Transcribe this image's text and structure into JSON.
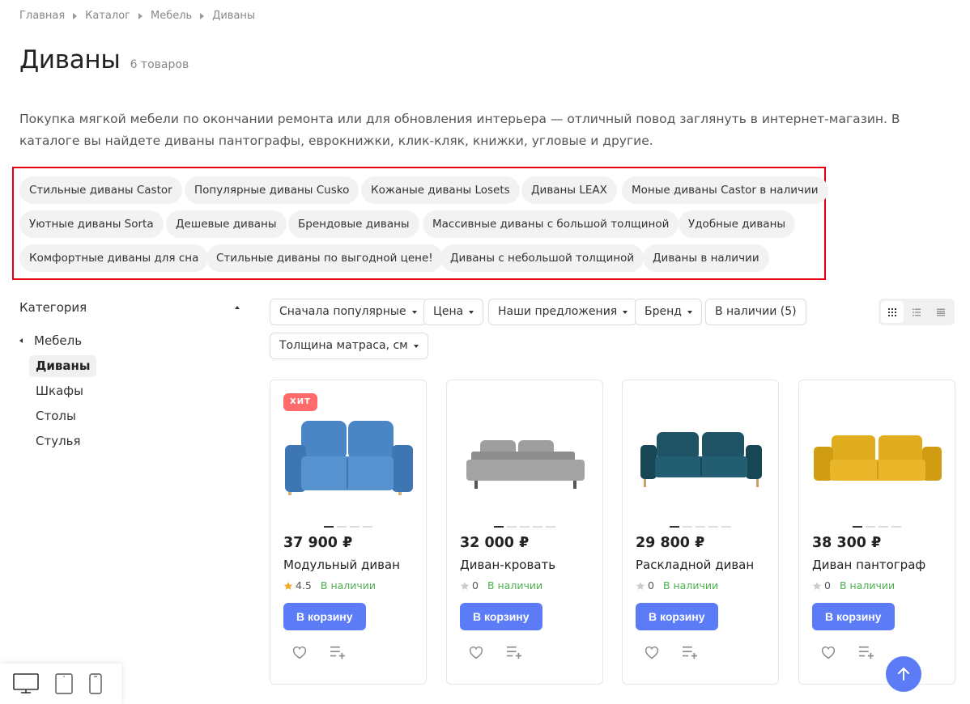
{
  "breadcrumb": [
    "Главная",
    "Каталог",
    "Мебель",
    "Диваны"
  ],
  "page": {
    "title": "Диваны",
    "count": "6 товаров",
    "description": "Покупка мягкой мебели по окончании ремонта или для обновления интерьера — отличный повод заглянуть в интернет-магазин. В каталоге вы найдете диваны пантографы, еврокнижки, клик-кляк, книжки, угловые и другие."
  },
  "tags": [
    "Стильные диваны Castor",
    "Популярные диваны Cusko",
    "Кожаные диваны Losets",
    "Диваны LEAX",
    "Моные диваны Castor в наличии",
    "Уютные диваны Sorta",
    "Дешевые диваны",
    "Брендовые диваны",
    "Массивные диваны с большой толщиной",
    "Удобные диваны",
    "Комфортные диваны для сна",
    "Стильные диваны по выгодной цене!",
    "Диваны с небольшой толщиной",
    "Диваны в наличии"
  ],
  "sidebar": {
    "title": "Категория",
    "parent": "Мебель",
    "items": [
      "Диваны",
      "Шкафы",
      "Столы",
      "Стулья"
    ],
    "active_index": 0
  },
  "filters": [
    "Сначала популярные",
    "Цена",
    "Наши предложения",
    "Бренд",
    "В наличии (5)",
    "Толщина матраса, см"
  ],
  "products": [
    {
      "badge": "ХИТ",
      "price": "37 900 ₽",
      "name": "Модульный диван",
      "rating": "4.5",
      "rated": true,
      "stock": "В наличии",
      "cart": "В корзину",
      "color": "#4a86c5"
    },
    {
      "badge": "",
      "price": "32 000 ₽",
      "name": "Диван-кровать",
      "rating": "0",
      "rated": false,
      "stock": "В наличии",
      "cart": "В корзину",
      "color": "#9a9a9a"
    },
    {
      "badge": "",
      "price": "29 800 ₽",
      "name": "Раскладной диван",
      "rating": "0",
      "rated": false,
      "stock": "В наличии",
      "cart": "В корзину",
      "color": "#1f5466"
    },
    {
      "badge": "",
      "price": "38 300 ₽",
      "name": "Диван пантограф",
      "rating": "0",
      "rated": false,
      "stock": "В наличии",
      "cart": "В корзину",
      "color": "#e0ad1f"
    }
  ],
  "colors": {
    "accent": "#5b7cf6",
    "badge": "#ff6b6b",
    "stock": "#4caf50",
    "highlight": "#e60012"
  }
}
